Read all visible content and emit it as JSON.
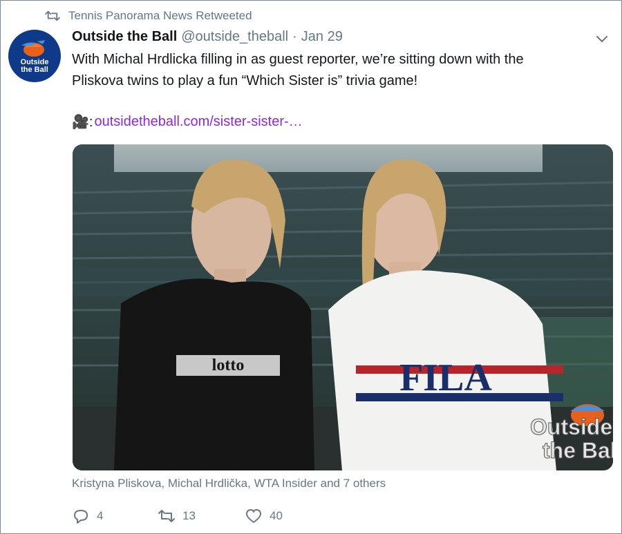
{
  "retweet": {
    "icon": "retweet-icon",
    "text": "Tennis Panorama News Retweeted"
  },
  "author": {
    "avatar_icon": "outside-the-ball-logo",
    "avatar_text_line1": "Outside",
    "avatar_text_line2": "the Ball",
    "name": "Outside the Ball",
    "handle": "@outside_theball",
    "separator": "·",
    "date": "Jan 29"
  },
  "tweet": {
    "text_line1": "With Michal Hrdlicka filling in as guest reporter, we’re sitting down with the",
    "text_line2": "Pliskova twins to play a fun “Which Sister is” trivia game!",
    "link_emoji": "🎥:",
    "link_text": "outsidetheball.com/sister-sister-…"
  },
  "media": {
    "watermark_line1": "Outside",
    "watermark_line2": "the Ball",
    "shirt_left_text": "lotto",
    "shirt_right_text": "FILA"
  },
  "tags": "Kristyna Pliskova, Michal Hrdlička, WTA Insider and 7 others",
  "actions": {
    "reply_count": "4",
    "retweet_count": "13",
    "like_count": "40"
  },
  "colors": {
    "link": "#8a28e0",
    "muted": "#657786",
    "avatar_bg": "#0f3a8a",
    "cap_orange": "#e8611a"
  }
}
